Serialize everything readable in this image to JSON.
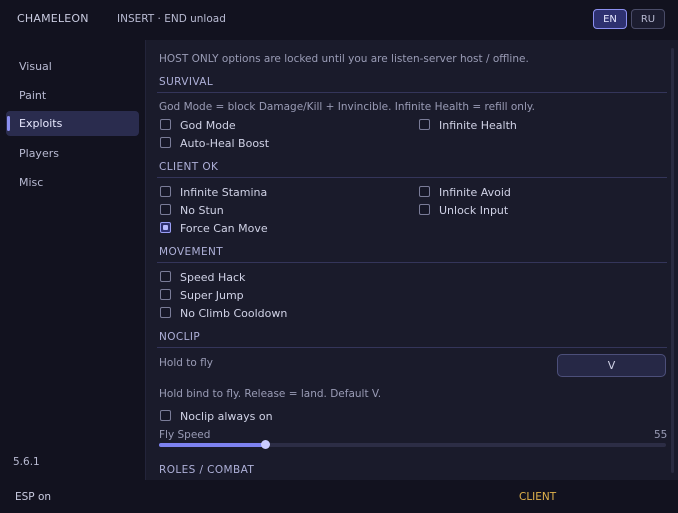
{
  "header": {
    "title": "CHAMELEON",
    "hint": "INSERT · END unload",
    "lang_en": "EN",
    "lang_ru": "RU"
  },
  "sidebar": {
    "items": [
      {
        "label": "Visual"
      },
      {
        "label": "Paint"
      },
      {
        "label": "Exploits"
      },
      {
        "label": "Players"
      },
      {
        "label": "Misc"
      }
    ],
    "active": "Exploits",
    "version": "5.6.1"
  },
  "main": {
    "host_notice": "HOST ONLY options are locked until you are listen-server host / offline.",
    "survival": {
      "title": "SURVIVAL",
      "note": "God Mode = block Damage/Kill + Invincible. Infinite Health = refill only.",
      "god_mode": {
        "label": "God Mode",
        "checked": false
      },
      "infinite_health": {
        "label": "Infinite Health",
        "checked": false
      },
      "auto_heal": {
        "label": "Auto-Heal Boost",
        "checked": false
      }
    },
    "client_ok": {
      "title": "CLIENT OK",
      "infinite_stamina": {
        "label": "Infinite Stamina",
        "checked": false
      },
      "infinite_avoid": {
        "label": "Infinite Avoid",
        "checked": false
      },
      "no_stun": {
        "label": "No Stun",
        "checked": false
      },
      "unlock_input": {
        "label": "Unlock Input",
        "checked": false
      },
      "force_can_move": {
        "label": "Force Can Move",
        "checked": true
      }
    },
    "movement": {
      "title": "MOVEMENT",
      "speed_hack": {
        "label": "Speed Hack",
        "checked": false
      },
      "super_jump": {
        "label": "Super Jump",
        "checked": false
      },
      "no_climb_cooldown": {
        "label": "No Climb Cooldown",
        "checked": false
      }
    },
    "noclip": {
      "title": "NOCLIP",
      "hold_label": "Hold to fly",
      "key": "V",
      "help": "Hold bind to fly. Release = land. Default V.",
      "always_on": {
        "label": "Noclip always on",
        "checked": false
      },
      "fly_speed_label": "Fly Speed",
      "fly_speed_value": "55",
      "fly_speed_fraction": 0.21
    },
    "roles": {
      "title": "ROLES / COMBAT"
    }
  },
  "statusbar": {
    "esp": "ESP on",
    "mode": "CLIENT"
  }
}
